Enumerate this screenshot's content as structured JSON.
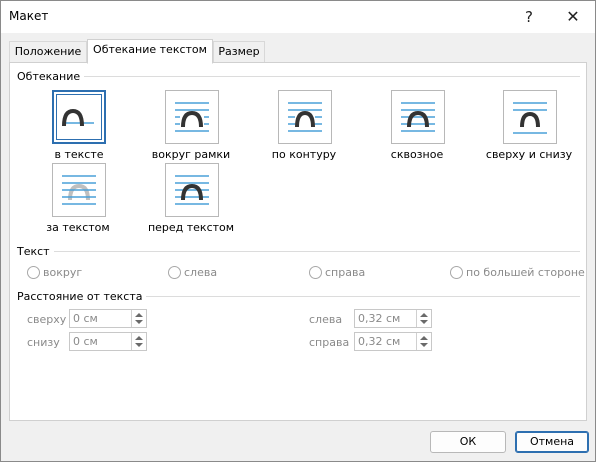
{
  "window": {
    "title": "Макет",
    "help": "?",
    "close": "✕"
  },
  "tabs": [
    {
      "label": "Положение"
    },
    {
      "label": "Обтекание текстом"
    },
    {
      "label": "Размер"
    }
  ],
  "wrapping": {
    "section_label": "Обтекание",
    "options": [
      {
        "label": "в тексте"
      },
      {
        "label": "вокруг рамки"
      },
      {
        "label": "по контуру"
      },
      {
        "label": "сквозное"
      },
      {
        "label": "сверху и снизу"
      },
      {
        "label": "за текстом"
      },
      {
        "label": "перед текстом"
      }
    ],
    "selected_option": "в тексте"
  },
  "text_section": {
    "label": "Текст",
    "radios": [
      {
        "label": "вокруг"
      },
      {
        "label": "слева"
      },
      {
        "label": "справа"
      },
      {
        "label": "по большей стороне"
      }
    ]
  },
  "distance": {
    "label": "Расстояние от текста",
    "fields": [
      {
        "label": "сверху",
        "value": "0 см"
      },
      {
        "label": "снизу",
        "value": "0 см"
      },
      {
        "label": "слева",
        "value": "0,32 см"
      },
      {
        "label": "справа",
        "value": "0,32 см"
      }
    ]
  },
  "buttons": {
    "ok": "ОК",
    "cancel": "Отмена"
  },
  "colors": {
    "accent": "#2d6fb0",
    "line": "#4aa0d8",
    "shape": "#333333"
  }
}
